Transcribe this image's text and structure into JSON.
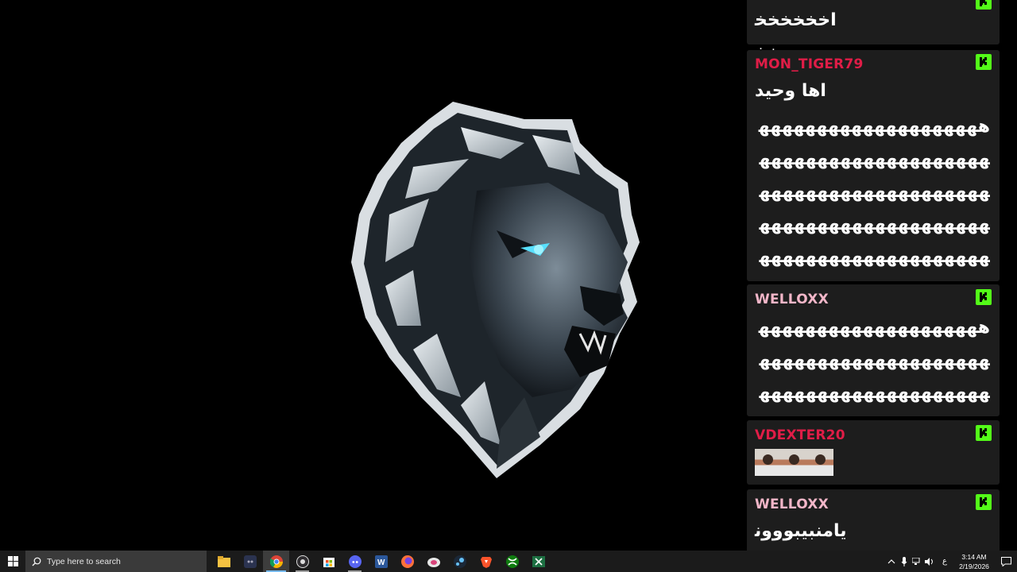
{
  "chat": {
    "messages": [
      {
        "username": "",
        "text": "اخخخخخخخخ",
        "color": "#ffffff",
        "has_badge": true
      },
      {
        "username": "MON_TIGER79",
        "text": "اها وحيد",
        "text2": "هههههههههههههههههههههههههههههههههههههههههههههههههههههههههههههههههههههههههههههههههههههههههههههههههههههههههههه",
        "color": "#e01d47",
        "has_badge": true
      },
      {
        "username": "WELLOXX",
        "text": "هههههههههههههههههههههههههههههههههههههههههههههههههههههههههههههههههه",
        "color": "#f2b6c8",
        "has_badge": true
      },
      {
        "username": "VDEXTER20",
        "emote": "three-faces-emote",
        "color": "#e01d47",
        "has_badge": true
      },
      {
        "username": "WELLOXX",
        "text": "يامنبيبووونذذ",
        "color": "#f2b6c8",
        "has_badge": true
      }
    ],
    "badge_letter": "K",
    "badge_color": "#53fc18"
  },
  "taskbar": {
    "search_placeholder": "Type here to search",
    "apps": [
      "file-explorer-icon",
      "discord-app-icon",
      "chrome-icon",
      "obs-icon",
      "microsoft-store-icon",
      "discord-icon",
      "word-icon",
      "firefox-icon",
      "mail-icon",
      "steam-icon",
      "brave-icon",
      "xbox-icon",
      "excel-icon"
    ],
    "clock_time": "3:14 AM",
    "clock_date": "2/19/2026",
    "tray_lang": "ع"
  }
}
